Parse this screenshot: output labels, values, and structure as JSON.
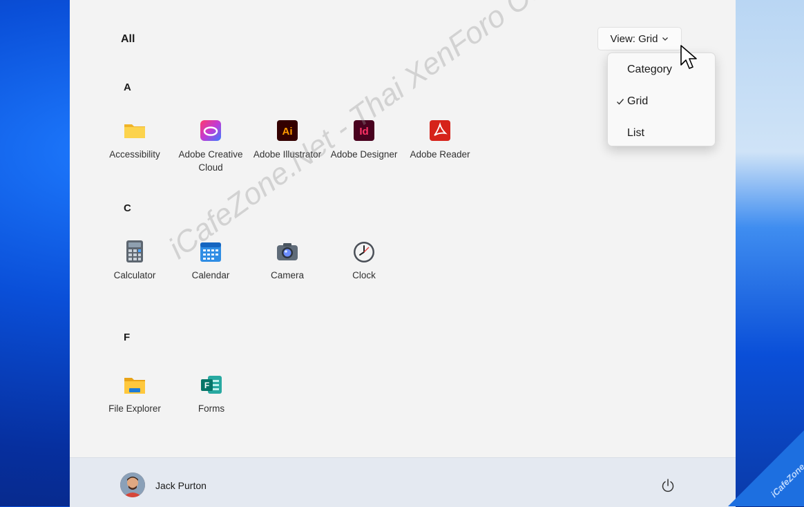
{
  "start_menu": {
    "section_title": "All",
    "view_button": {
      "label": "View: Grid",
      "icon": "chevron-down-icon"
    },
    "view_menu": {
      "items": [
        {
          "label": "Category",
          "checked": false
        },
        {
          "label": "Grid",
          "checked": true
        },
        {
          "label": "List",
          "checked": false
        }
      ]
    },
    "groups": [
      {
        "letter": "A",
        "apps": [
          {
            "label": "Accessibility",
            "icon": "folder-icon"
          },
          {
            "label": "Adobe Creative Cloud",
            "icon": "adobe-creative-cloud-icon"
          },
          {
            "label": "Adobe Illustrator",
            "icon": "adobe-illustrator-icon",
            "icon_text": "Ai"
          },
          {
            "label": "Adobe Designer",
            "icon": "adobe-indesign-icon",
            "icon_text": "Id"
          },
          {
            "label": "Adobe Reader",
            "icon": "adobe-reader-icon"
          }
        ]
      },
      {
        "letter": "C",
        "apps": [
          {
            "label": "Calculator",
            "icon": "calculator-icon"
          },
          {
            "label": "Calendar",
            "icon": "calendar-icon"
          },
          {
            "label": "Camera",
            "icon": "camera-icon"
          },
          {
            "label": "Clock",
            "icon": "clock-icon"
          }
        ]
      },
      {
        "letter": "F",
        "apps": [
          {
            "label": "File Explorer",
            "icon": "file-explorer-icon"
          },
          {
            "label": "Forms",
            "icon": "forms-icon",
            "icon_text": "F"
          }
        ]
      }
    ],
    "footer": {
      "user_name": "Jack Purton",
      "power_icon": "power-icon"
    }
  },
  "watermark": {
    "text": "iCafeZone.Net - Thai XenForo Community",
    "corner_text": "iCafeZone"
  },
  "colors": {
    "menu_bg": "#f3f3f3",
    "footer_bg": "#e4e9f1",
    "illustrator": "#330000",
    "illustrator_text": "#ff9a00",
    "indesign": "#49021f",
    "indesign_text": "#ff3366",
    "reader": "#d6231a"
  }
}
